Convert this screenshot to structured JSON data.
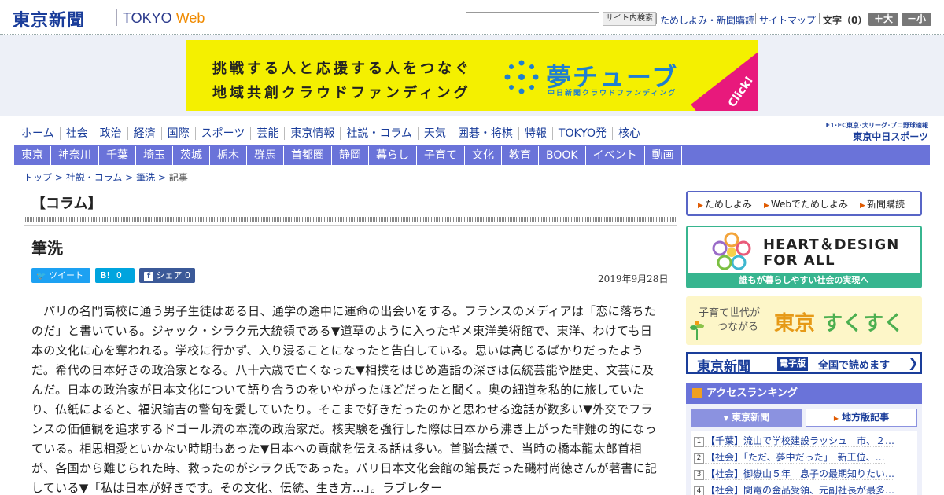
{
  "header": {
    "logo": "東京新聞",
    "logo_en_prefix": "TOKYO",
    "logo_en_suffix": "Web",
    "search_button": "サイト内検索",
    "util_links": [
      "ためしよみ・新聞購読",
      "サイトマップ"
    ],
    "font_size_label": "文字（0）",
    "font_larger": "＋大",
    "font_smaller": "－小"
  },
  "ad": {
    "line1": "挑戦する人と応援する人をつなぐ",
    "line2": "地域共創クラウドファンディング",
    "brand": "夢チューブ",
    "brand_sub": "中日新聞クラウドファンディング",
    "click": "Click!"
  },
  "global_nav": [
    "ホーム",
    "社会",
    "政治",
    "経済",
    "国際",
    "スポーツ",
    "芸能",
    "東京情報",
    "社説・コラム",
    "天気",
    "囲碁・将棋",
    "特報",
    "TOKYO発",
    "核心"
  ],
  "chunichi": {
    "sub": "F1･FC東京･大リーグ･プロ野球速報",
    "main": "東京中日スポーツ"
  },
  "local_nav": [
    "東京",
    "神奈川",
    "千葉",
    "埼玉",
    "茨城",
    "栃木",
    "群馬",
    "首都圏",
    "静岡",
    "暮らし",
    "子育て",
    "文化",
    "教育",
    "BOOK",
    "イベント",
    "動画"
  ],
  "breadcrumb": {
    "top": "トップ",
    "sep": ">",
    "section": "社説・コラム",
    "sub": "筆洗",
    "current": "記事"
  },
  "article": {
    "column_label": "【コラム】",
    "title": "筆洗",
    "share_tweet": "ツイート",
    "share_hatena": "B!",
    "share_hatena_count": "0",
    "share_fb": "シェア",
    "share_fb_count": "0",
    "date": "2019年9月28日",
    "body": "パリの名門高校に通う男子生徒はある日、通学の途中に運命の出会いをする。フランスのメディアは「恋に落ちたのだ」と書いている。ジャック・シラク元大統領である▼道草のように入ったギメ東洋美術館で、東洋、わけても日本の文化に心を奪われる。学校に行かず、入り浸ることになったと告白している。思いは高じるばかりだったようだ。希代の日本好きの政治家となる。八十六歳で亡くなった▼相撲をはじめ造詣の深さは伝統芸能や歴史、文芸に及んだ。日本の政治家が日本文化について語り合うのをいやがったほどだったと聞く。奥の細道を私的に旅していたり、仏紙によると、福沢諭吉の警句を愛していたり。そこまで好きだったのかと思わせる逸話が数多い▼外交でフランスの価値観を追求するドゴール流の本流の政治家だ。核実験を強行した際は日本から沸き上がった非難の的になっている。相思相愛といかない時期もあった▼日本への貢献を伝える話は多い。首脳会議で、当時の橋本龍太郎首相が、各国から難じられた時、救ったのがシラク氏であった。パリ日本文化会館の館長だった磯村尚徳さんが著書に記している▼「私は日本が好きです。その文化、伝統、生き方…」。ラブレター"
  },
  "sidebar": {
    "links": [
      "ためしよみ",
      "Webでためしよみ",
      "新聞購読"
    ],
    "hd_title1": "HEART＆DESIGN",
    "hd_title2": "FOR ALL",
    "hd_foot": "誰もが暮らしやすい社会の実現へ",
    "suku_sub1": "子育て世代が",
    "suku_sub2": "つながる",
    "suku_main_a": "東京",
    "suku_main_b": "すくすく",
    "ep_logo": "東京新聞",
    "ep_badge": "電子版",
    "ep_text": "全国で読めます",
    "ranking_title": "アクセスランキング",
    "tab_tokyo": "東京新聞",
    "tab_local": "地方版記事",
    "ranking": [
      {
        "num": "1",
        "text": "【千葉】流山で学校建設ラッシュ　市、２…"
      },
      {
        "num": "2",
        "text": "【社会】「ただ、夢中だった」　新王位、…"
      },
      {
        "num": "3",
        "text": "【社会】御嶽山５年　息子の最期知りたい…"
      },
      {
        "num": "4",
        "text": "【社会】関電の金品受領、元副社長が最多…"
      }
    ]
  },
  "colors": {
    "brand": "#1a3d9a",
    "nav_bg": "#6a73d9",
    "ad_bg": "#f4f000",
    "twitter": "#1da1f2",
    "hatena": "#00a4de",
    "facebook": "#3b5998"
  }
}
